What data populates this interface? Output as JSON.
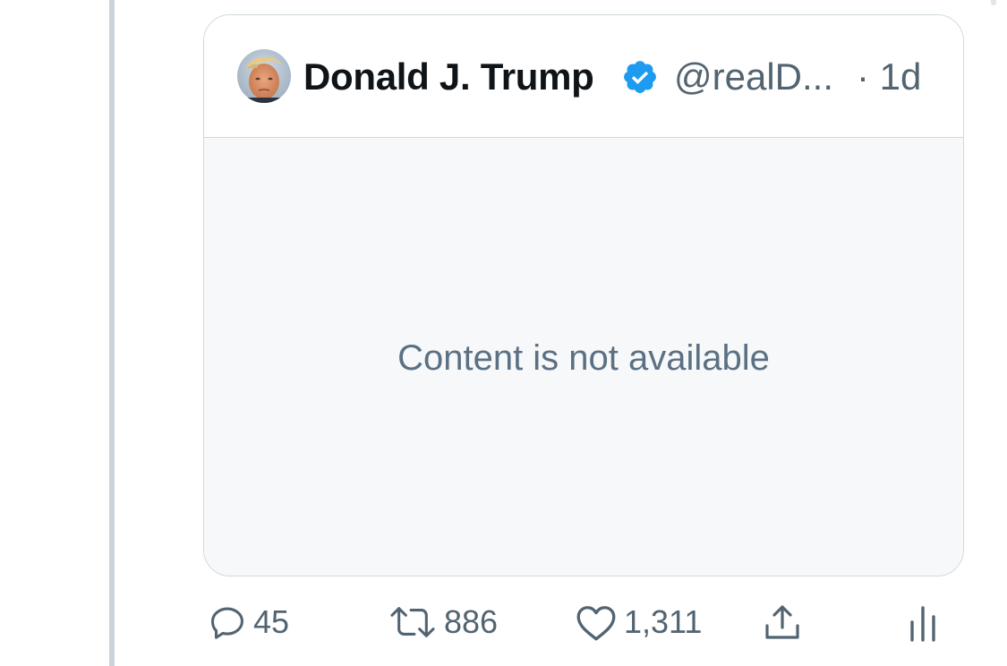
{
  "quoted_tweet": {
    "display_name": "Donald J. Trump",
    "handle": "@realD...",
    "timestamp": "· 1d",
    "verified": true,
    "avatar": "profile-photo",
    "body_message": "Content is not available"
  },
  "actions": {
    "reply": {
      "icon": "reply-icon",
      "count": "45"
    },
    "retweet": {
      "icon": "retweet-icon",
      "count": "886"
    },
    "like": {
      "icon": "heart-icon",
      "count": "1,311"
    },
    "share": {
      "icon": "share-icon"
    },
    "analytics": {
      "icon": "analytics-icon"
    }
  },
  "colors": {
    "primary_text": "#0f1419",
    "secondary_text": "#536471",
    "verified_blue": "#1d9bf0",
    "card_border": "#cfd9de",
    "card_body_bg": "#f7f8fa",
    "thread_line": "#ccd3d9"
  }
}
